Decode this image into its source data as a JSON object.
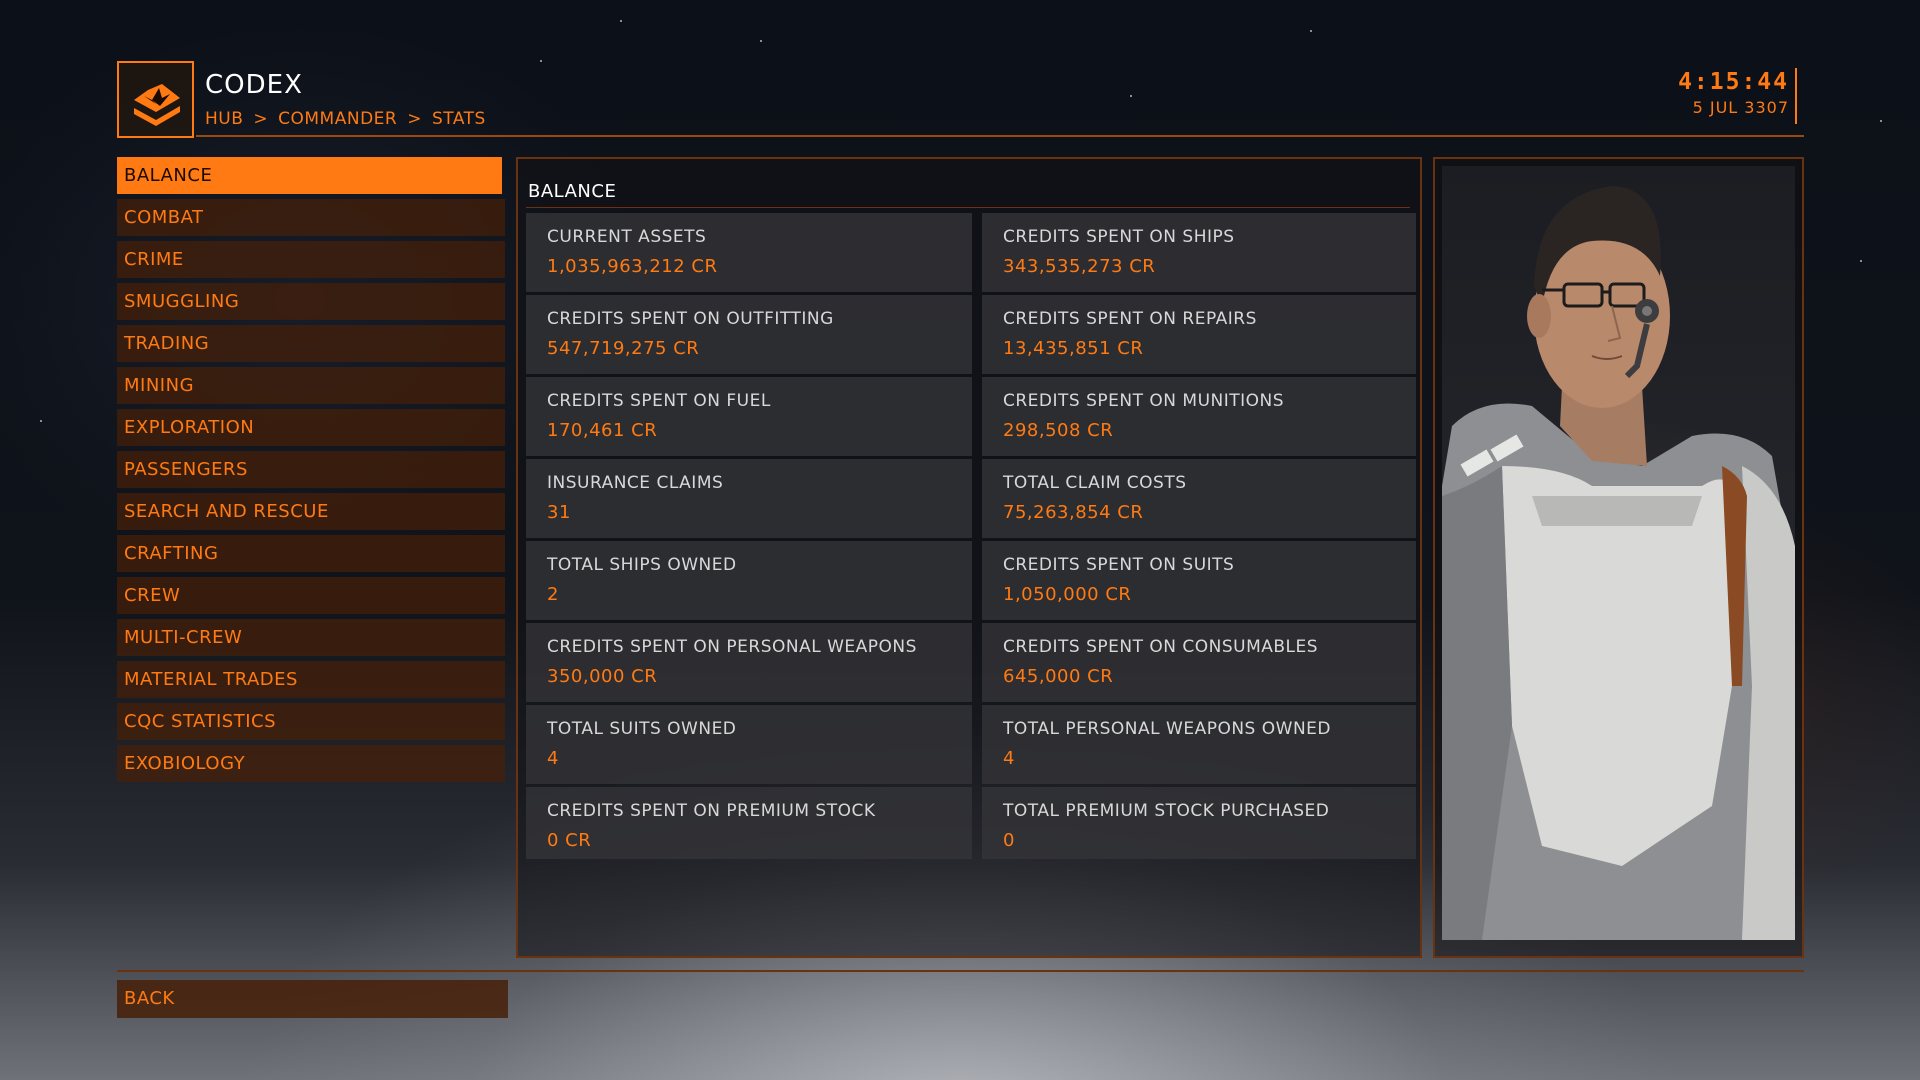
{
  "header": {
    "title": "CODEX",
    "breadcrumb": [
      "HUB",
      "COMMANDER",
      "STATS"
    ],
    "breadcrumb_separator": ">",
    "time": "4:15:44",
    "date": "5 JUL 3307"
  },
  "sidebar": {
    "items": [
      {
        "label": "BALANCE",
        "active": true
      },
      {
        "label": "COMBAT"
      },
      {
        "label": "CRIME"
      },
      {
        "label": "SMUGGLING"
      },
      {
        "label": "TRADING"
      },
      {
        "label": "MINING"
      },
      {
        "label": "EXPLORATION"
      },
      {
        "label": "PASSENGERS"
      },
      {
        "label": "SEARCH AND RESCUE"
      },
      {
        "label": "CRAFTING"
      },
      {
        "label": "CREW"
      },
      {
        "label": "MULTI-CREW"
      },
      {
        "label": "MATERIAL TRADES"
      },
      {
        "label": "CQC STATISTICS"
      },
      {
        "label": "EXOBIOLOGY"
      }
    ]
  },
  "panel": {
    "title": "BALANCE",
    "stats": [
      {
        "label": "CURRENT ASSETS",
        "value": "1,035,963,212 CR"
      },
      {
        "label": "CREDITS SPENT ON SHIPS",
        "value": "343,535,273 CR"
      },
      {
        "label": "CREDITS SPENT ON OUTFITTING",
        "value": "547,719,275 CR"
      },
      {
        "label": "CREDITS SPENT ON REPAIRS",
        "value": "13,435,851 CR"
      },
      {
        "label": "CREDITS SPENT ON FUEL",
        "value": "170,461 CR"
      },
      {
        "label": "CREDITS SPENT ON MUNITIONS",
        "value": "298,508 CR"
      },
      {
        "label": "INSURANCE CLAIMS",
        "value": "31"
      },
      {
        "label": "TOTAL CLAIM COSTS",
        "value": "75,263,854 CR"
      },
      {
        "label": "TOTAL SHIPS OWNED",
        "value": "2"
      },
      {
        "label": "CREDITS SPENT ON SUITS",
        "value": "1,050,000 CR"
      },
      {
        "label": "CREDITS SPENT ON PERSONAL WEAPONS",
        "value": "350,000 CR"
      },
      {
        "label": "CREDITS SPENT ON CONSUMABLES",
        "value": "645,000 CR"
      },
      {
        "label": "TOTAL SUITS OWNED",
        "value": "4"
      },
      {
        "label": "TOTAL PERSONAL WEAPONS OWNED",
        "value": "4"
      },
      {
        "label": "CREDITS SPENT ON PREMIUM STOCK",
        "value": "0 CR"
      },
      {
        "label": "TOTAL PREMIUM STOCK PURCHASED",
        "value": "0"
      }
    ]
  },
  "footer": {
    "back_label": "BACK"
  },
  "icons": {
    "logo": "codex-book-icon",
    "portrait": "commander-portrait"
  },
  "colors": {
    "accent": "#ff7a12",
    "panel_bg": "#343438",
    "border": "#6b3210"
  }
}
